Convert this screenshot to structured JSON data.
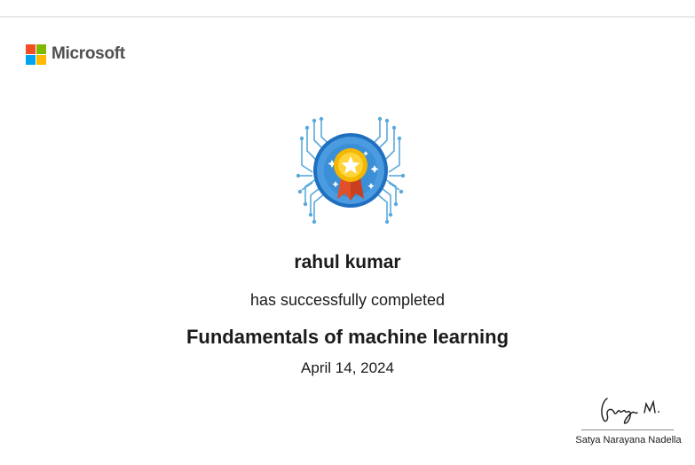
{
  "brand": {
    "name": "Microsoft",
    "logo_colors": [
      "#f25022",
      "#7fba00",
      "#00a4ef",
      "#ffb900"
    ]
  },
  "badge": {
    "icon": "achievement-medal-icon"
  },
  "certificate": {
    "recipient": "rahul kumar",
    "statement": "has successfully completed",
    "course": "Fundamentals of machine learning",
    "date": "April 14, 2024"
  },
  "signature": {
    "signer_name": "Satya Narayana Nadella"
  },
  "colors": {
    "badge_blue": "#3b8fd6",
    "circuit_blue": "#5aa9dc",
    "medal_gold": "#f5b800",
    "ribbon_red": "#e0502a"
  }
}
